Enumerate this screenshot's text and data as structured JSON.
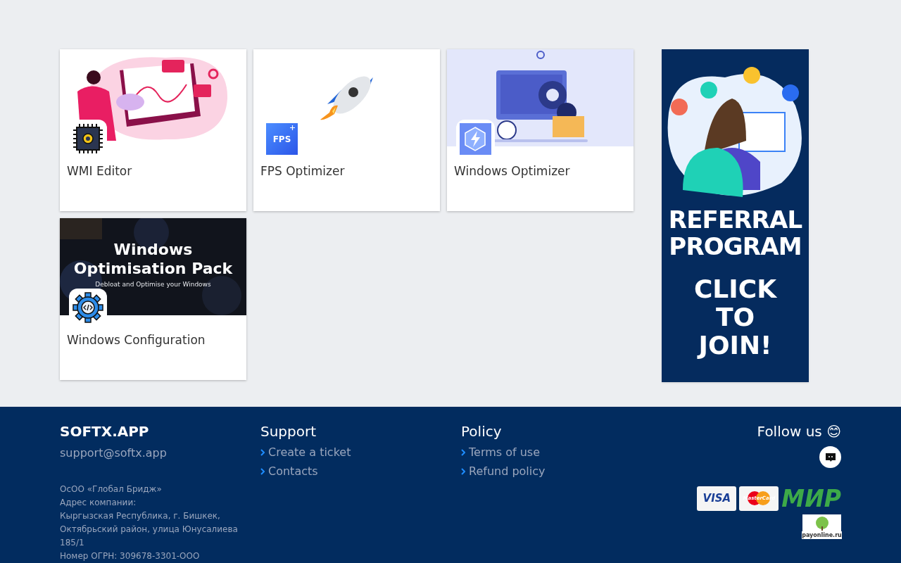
{
  "cards": [
    {
      "title": "WMI Editor"
    },
    {
      "title": "FPS Optimizer",
      "icon_text": "FPS"
    },
    {
      "title": "Windows Optimizer"
    },
    {
      "title": "Windows Configuration",
      "art_lines": [
        "Windows",
        "Optimisation Pack",
        "Debloat and Optimise your Windows"
      ]
    }
  ],
  "banner": {
    "lines": [
      "REFERRAL",
      "PROGRAM"
    ],
    "cta": [
      "CLICK",
      "TO",
      "JOIN!"
    ]
  },
  "footer": {
    "brand": "SOFTX.APP",
    "email": "support@softx.app",
    "company_lines": [
      "ОсОО «Глобал Бридж»",
      "Адрес компании:",
      "Кыргызская Республика, г. Бишкек,",
      "Октябрьский район, улица Юнусалиева",
      "185/1",
      "Номер ОГРН: 309678-3301-ООО"
    ],
    "columns": [
      {
        "title": "Support",
        "links": [
          "Create a ticket",
          "Contacts"
        ]
      },
      {
        "title": "Policy",
        "links": [
          "Terms of use",
          "Refund policy"
        ]
      }
    ],
    "follow": "Follow us 😊",
    "payments": [
      {
        "kind": "visa",
        "label": "VISA"
      },
      {
        "kind": "mastercard",
        "label": "MasterCard"
      },
      {
        "kind": "mir",
        "label": "МИР"
      },
      {
        "kind": "payonline",
        "label": "payonline.ru"
      }
    ]
  }
}
